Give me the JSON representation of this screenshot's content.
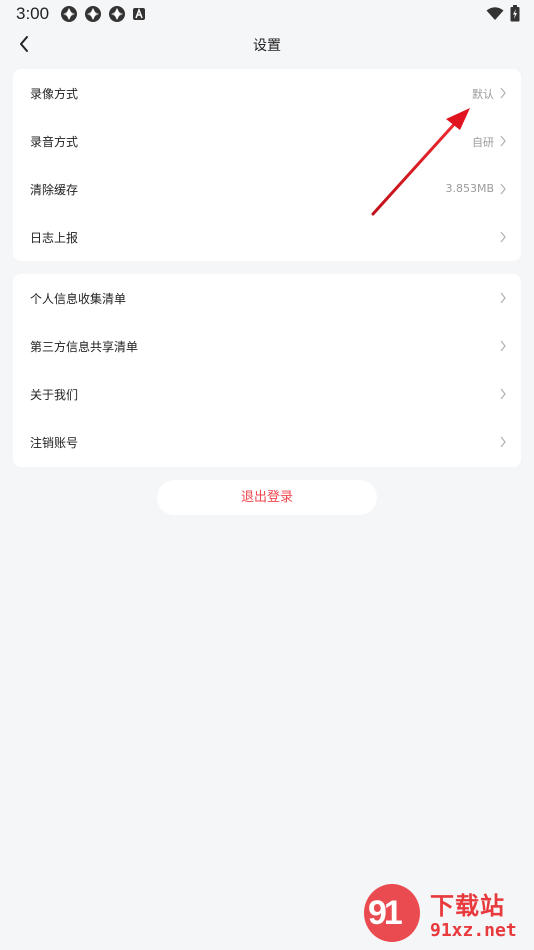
{
  "status_bar": {
    "time": "3:00",
    "left_icons": [
      "app-notification-icon",
      "app-notification-icon",
      "app-notification-icon",
      "text-notification-icon"
    ],
    "right_icons": [
      "wifi-icon",
      "battery-icon"
    ]
  },
  "header": {
    "title": "设置",
    "back_icon": "chevron-left-icon"
  },
  "section1": {
    "items": [
      {
        "label": "录像方式",
        "value": "默认"
      },
      {
        "label": "录音方式",
        "value": "自研"
      },
      {
        "label": "清除缓存",
        "value": "3.853MB"
      },
      {
        "label": "日志上报",
        "value": ""
      }
    ]
  },
  "section2": {
    "items": [
      {
        "label": "个人信息收集清单"
      },
      {
        "label": "第三方信息共享清单"
      },
      {
        "label": "关于我们"
      },
      {
        "label": "注销账号"
      }
    ]
  },
  "logout": {
    "label": "退出登录"
  },
  "watermark": {
    "logo": "91",
    "title": "下载站",
    "domain": "91xz.net"
  },
  "colors": {
    "background": "#f5f6f8",
    "card": "#ffffff",
    "logout_text": "#f0474f",
    "annotation_arrow": "#e0141e",
    "watermark": "#e8393d"
  }
}
